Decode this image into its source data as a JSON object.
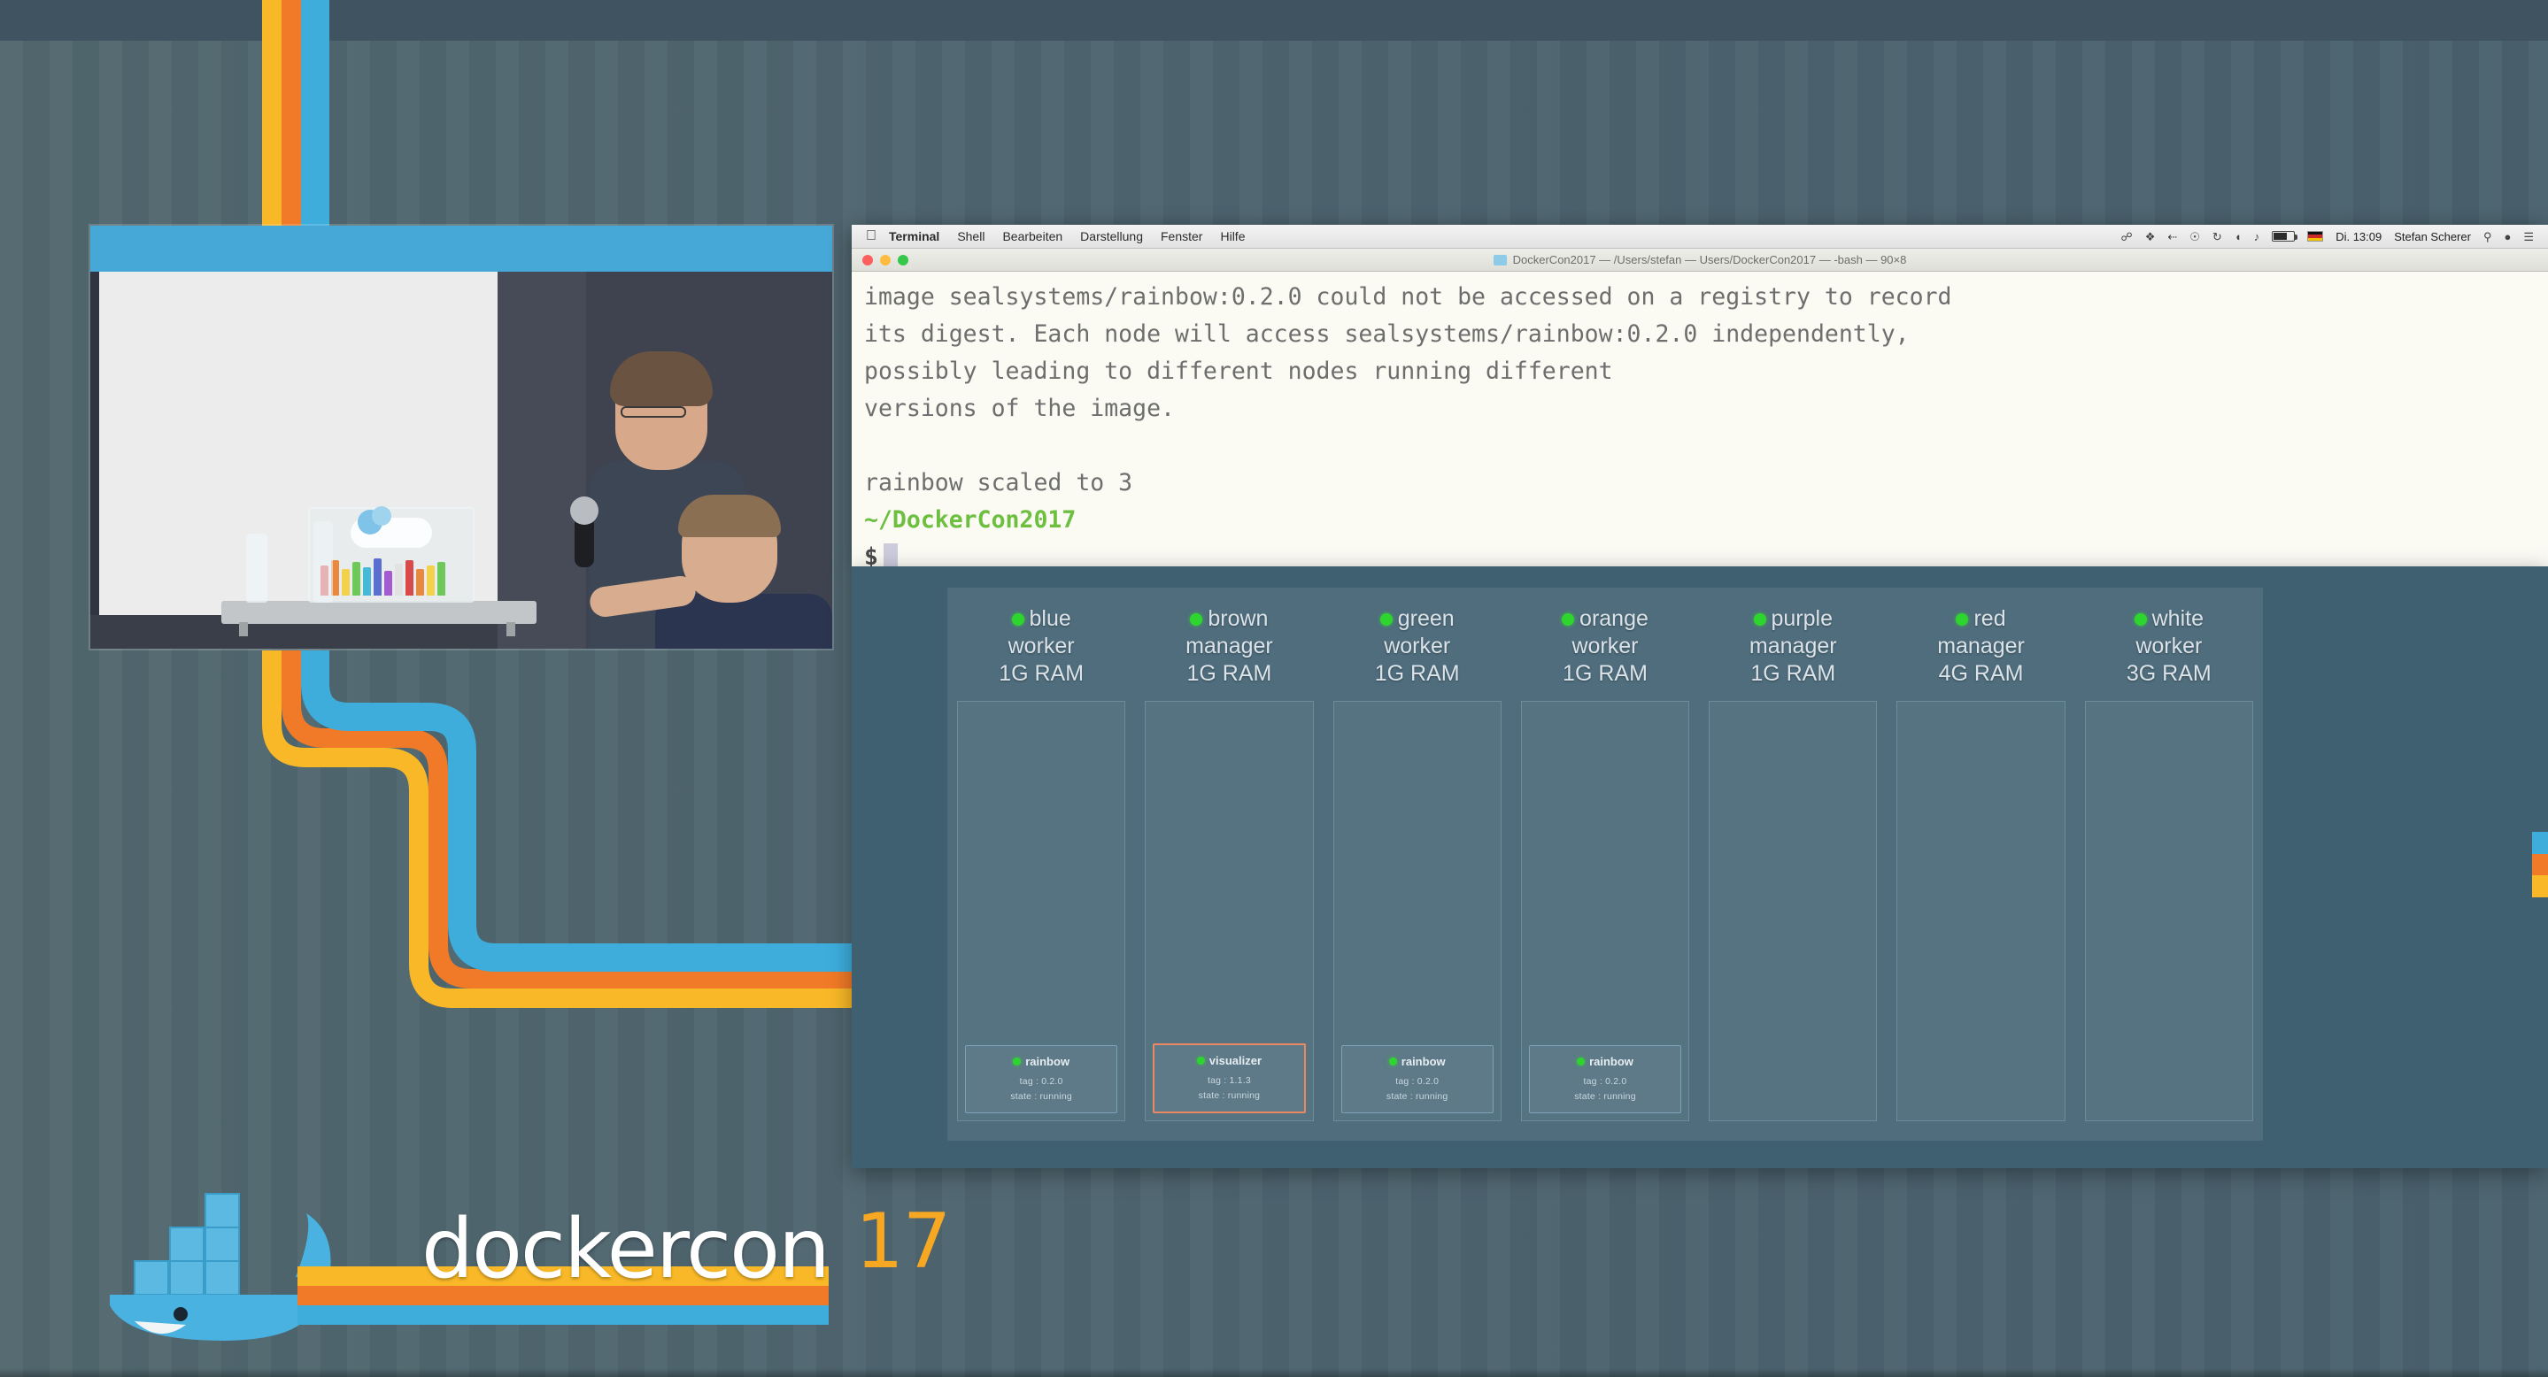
{
  "backdrop": {
    "brand_colors": {
      "blue": "#3eaddc",
      "orange": "#f07a27",
      "yellow": "#f8b827",
      "teal_bg": "#4d6470"
    },
    "logo": {
      "word": "dockercon",
      "year": "17"
    }
  },
  "macos": {
    "menu": {
      "apple_icon": "apple-logo-icon",
      "items": [
        {
          "label": "Terminal",
          "bold": true
        },
        {
          "label": "Shell",
          "bold": false
        },
        {
          "label": "Bearbeiten",
          "bold": false
        },
        {
          "label": "Darstellung",
          "bold": false
        },
        {
          "label": "Fenster",
          "bold": false
        },
        {
          "label": "Hilfe",
          "bold": false
        }
      ],
      "status": {
        "clock": "Di. 13:09",
        "user": "Stefan Scherer",
        "icons": [
          "usb-icon",
          "dropbox-icon",
          "bluetooth-icon",
          "vpn-icon",
          "timemachine-icon",
          "wifi-icon",
          "volume-icon",
          "battery-icon",
          "flag-de-icon",
          "spotlight-search-icon",
          "siri-icon",
          "notification-center-icon"
        ]
      }
    },
    "window": {
      "traffic_lights": [
        "close-button",
        "minimize-button",
        "zoom-button"
      ],
      "title": "DockerCon2017 — /Users/stefan — Users/DockerCon2017 — -bash — 90×8",
      "folder_icon": "folder-icon"
    }
  },
  "terminal": {
    "lines": [
      {
        "text": "image sealsystems/rainbow:0.2.0 could not be accessed on a registry to record",
        "style": "normal"
      },
      {
        "text": "its digest. Each node will access sealsystems/rainbow:0.2.0 independently,",
        "style": "normal"
      },
      {
        "text": "possibly leading to different nodes running different",
        "style": "normal"
      },
      {
        "text": "versions of the image.",
        "style": "normal"
      },
      {
        "text": "",
        "style": "normal"
      },
      {
        "text": "rainbow scaled to 3",
        "style": "normal"
      },
      {
        "text": "~/DockerCon2017",
        "style": "green"
      }
    ],
    "prompt_symbol": "$",
    "prompt_input": ""
  },
  "visualizer": {
    "nodes": [
      {
        "name": "blue",
        "role": "worker",
        "ram": "1G RAM",
        "status": "online",
        "tasks": [
          {
            "name": "rainbow",
            "tag_label": "tag",
            "tag": "0.2.0",
            "state_label": "state",
            "state": "running",
            "highlighted": false
          }
        ]
      },
      {
        "name": "brown",
        "role": "manager",
        "ram": "1G RAM",
        "status": "online",
        "tasks": [
          {
            "name": "visualizer",
            "tag_label": "tag",
            "tag": "1.1.3",
            "state_label": "state",
            "state": "running",
            "highlighted": true
          }
        ]
      },
      {
        "name": "green",
        "role": "worker",
        "ram": "1G RAM",
        "status": "online",
        "tasks": [
          {
            "name": "rainbow",
            "tag_label": "tag",
            "tag": "0.2.0",
            "state_label": "state",
            "state": "running",
            "highlighted": false
          }
        ]
      },
      {
        "name": "orange",
        "role": "worker",
        "ram": "1G RAM",
        "status": "online",
        "tasks": [
          {
            "name": "rainbow",
            "tag_label": "tag",
            "tag": "0.2.0",
            "state_label": "state",
            "state": "running",
            "highlighted": false
          }
        ]
      },
      {
        "name": "purple",
        "role": "manager",
        "ram": "1G RAM",
        "status": "online",
        "tasks": []
      },
      {
        "name": "red",
        "role": "manager",
        "ram": "4G RAM",
        "status": "online",
        "tasks": []
      },
      {
        "name": "white",
        "role": "worker",
        "ram": "3G RAM",
        "status": "online",
        "tasks": []
      }
    ]
  },
  "video_inset": {
    "description": "conference stage camera feed",
    "objects": [
      "presenter-with-microphone",
      "seated-person",
      "raspberry-pi-cluster-rack",
      "water-bottles",
      "whiteboard"
    ]
  }
}
